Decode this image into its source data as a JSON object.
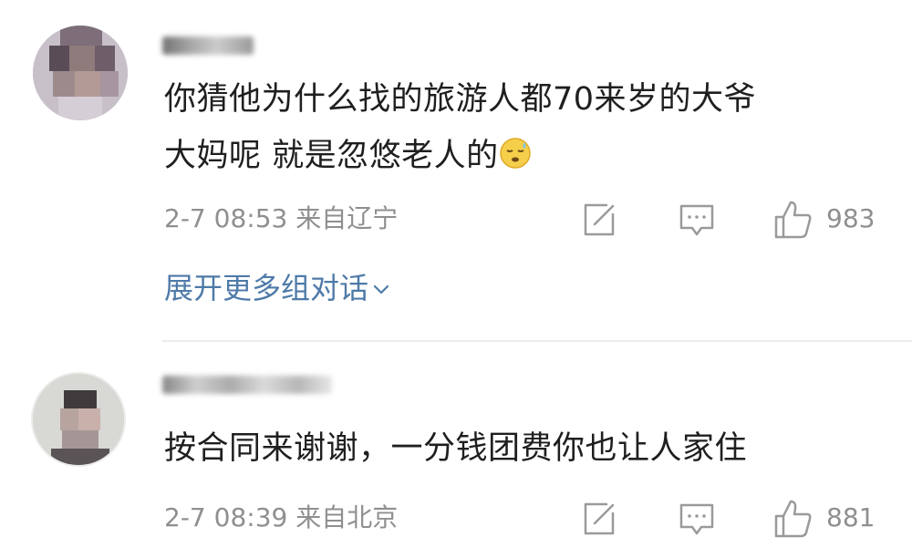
{
  "comments": [
    {
      "text_line1": "你猜他为什么找的旅游人都70来岁的大爷",
      "text_line2": "大妈呢 就是忽悠老人的",
      "emoji": "sweat-face-emoji",
      "time": "2-7 08:53",
      "location": "来自辽宁",
      "likes": "983",
      "expand_label": "展开更多组对话"
    },
    {
      "text": "按合同来谢谢，一分钱团费你也让人家住",
      "time": "2-7 08:39",
      "location": "来自北京",
      "likes": "881"
    }
  ],
  "icons": {
    "repost": "repost-icon",
    "reply": "comment-icon",
    "like": "thumbs-up-icon",
    "expand": "chevron-down-icon"
  },
  "colors": {
    "link": "#4e7aa8",
    "meta": "#8f8f8f",
    "text": "#1f1f1f",
    "icon": "#9a9a9a"
  }
}
